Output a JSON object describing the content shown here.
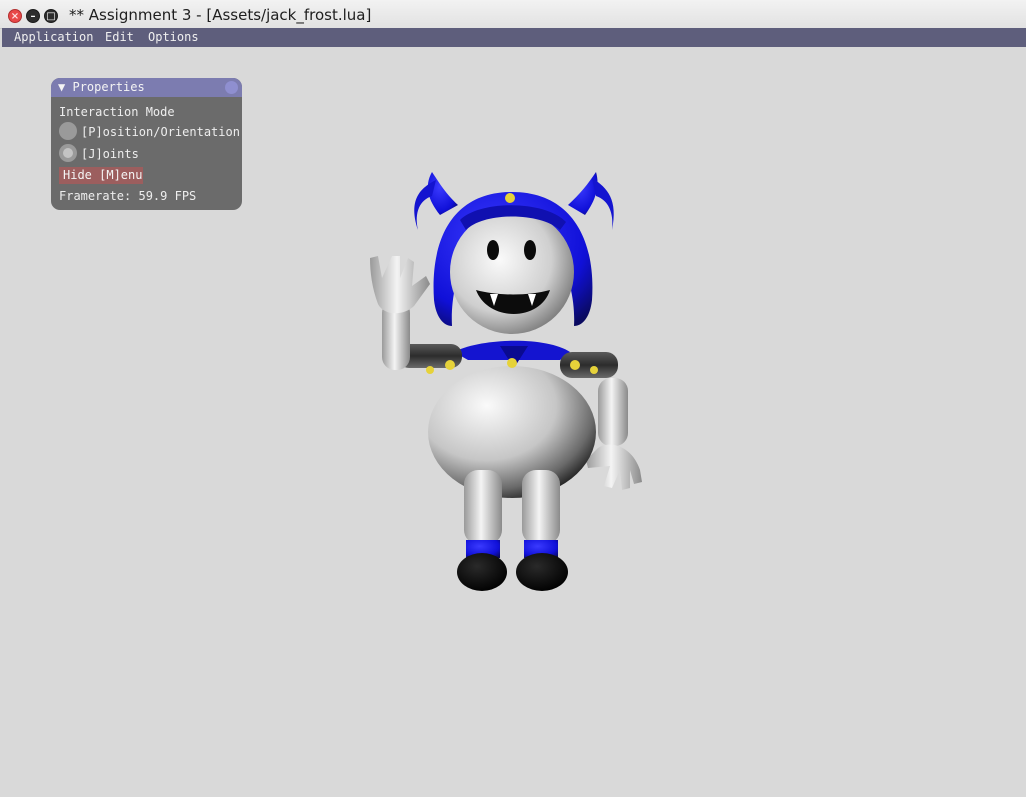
{
  "window": {
    "title": "** Assignment 3 - [Assets/jack_frost.lua]",
    "close_glyph": "×",
    "minimize_glyph": "–",
    "maximize_glyph": "□"
  },
  "menubar": {
    "items": [
      "Application",
      "Edit",
      "Options"
    ]
  },
  "properties_panel": {
    "title": "Properties",
    "collapse_glyph": "▼",
    "section_label": "Interaction Mode",
    "radio_options": [
      {
        "label": "[P]osition/Orientation",
        "selected": false
      },
      {
        "label": "[J]oints",
        "selected": true
      }
    ],
    "hide_button": "Hide [M]enu",
    "framerate": "Framerate: 59.9 FPS"
  },
  "colors": {
    "background": "#d9d9d9",
    "menubar": "#5e5e7c",
    "panel_body": "#6b6b6b",
    "panel_header": "#7c7cb0",
    "hide_button": "#9c5e5e",
    "model_blue": "#1a1ae0",
    "model_white": "#f0f0f0",
    "model_gold": "#e6d23a"
  },
  "scene": {
    "model_name": "jack_frost"
  }
}
